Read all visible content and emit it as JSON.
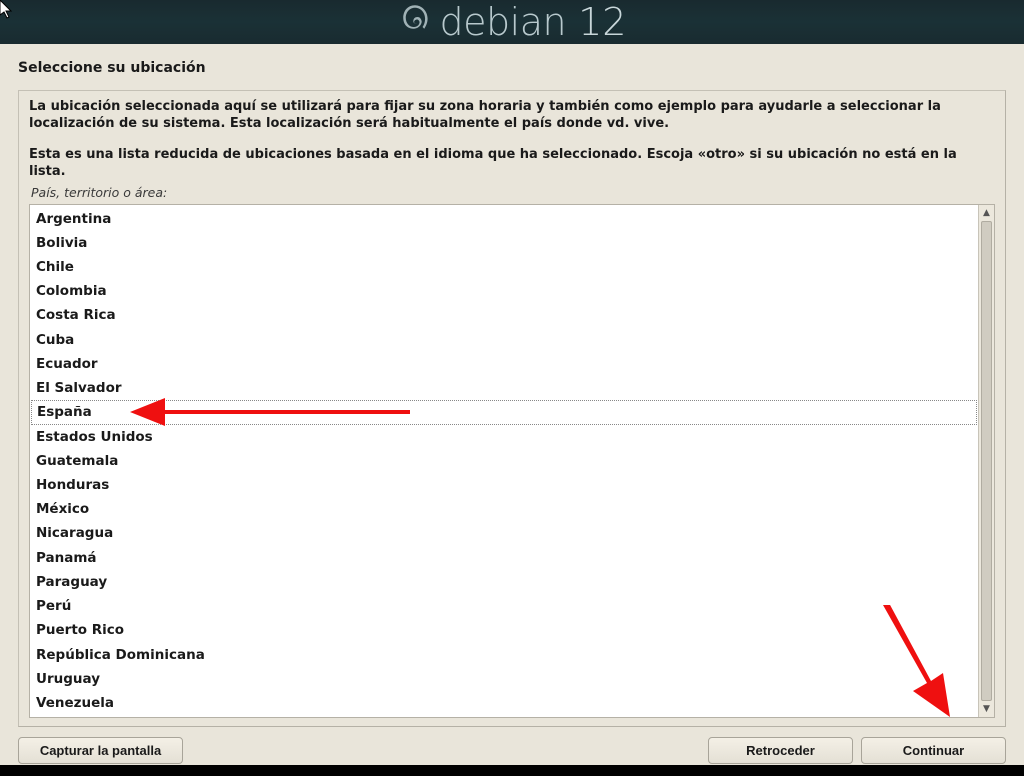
{
  "header": {
    "brand": "debian",
    "version": "12"
  },
  "page": {
    "title": "Seleccione su ubicación",
    "description1": "La ubicación seleccionada aquí se utilizará para fijar su zona horaria y también como ejemplo para ayudarle a seleccionar la localización de su sistema. Esta localización será habitualmente el país donde vd. vive.",
    "description2": "Esta es una lista reducida de ubicaciones basada en el idioma que ha seleccionado. Escoja «otro» si su ubicación no está en la lista.",
    "field_label": "País, territorio o área:"
  },
  "countries": [
    "Argentina",
    "Bolivia",
    "Chile",
    "Colombia",
    "Costa Rica",
    "Cuba",
    "Ecuador",
    "El Salvador",
    "España",
    "Estados Unidos",
    "Guatemala",
    "Honduras",
    "México",
    "Nicaragua",
    "Panamá",
    "Paraguay",
    "Perú",
    "Puerto Rico",
    "República Dominicana",
    "Uruguay",
    "Venezuela"
  ],
  "selected_index": 8,
  "buttons": {
    "screenshot": "Capturar la pantalla",
    "back": "Retroceder",
    "continue": "Continuar"
  },
  "colors": {
    "header_bg": "#1a3136",
    "header_text": "#b8c9cd",
    "page_bg": "#e9e5da",
    "arrow": "#ef1010"
  }
}
